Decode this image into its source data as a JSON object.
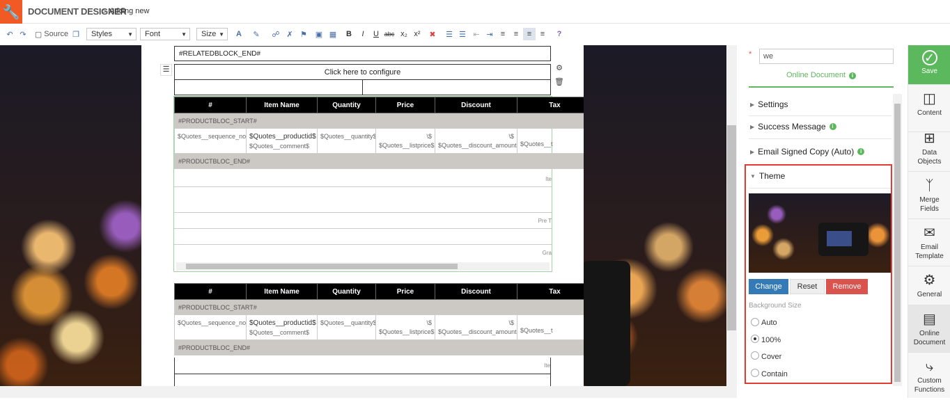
{
  "header": {
    "title": "DOCUMENT DESIGNER",
    "separator": ">",
    "breadcrumb": "Adding new"
  },
  "toolbar": {
    "source_label": "Source",
    "styles_label": "Styles",
    "font_label": "Font",
    "size_label": "Size",
    "help": "?"
  },
  "document": {
    "related_block_end": "#RELATEDBLOCK_END#",
    "configure": "Click here to configure",
    "headers": [
      "#",
      "Item Name",
      "Quantity",
      "Price",
      "Discount",
      "Tax"
    ],
    "block_start": "#PRODUCTBLOC_START#",
    "block_end": "#PRODUCTBLOC_END#",
    "row": {
      "seq": "$Quotes__sequence_no$",
      "product": "$Quotes__productid$",
      "comment": "$Quotes__comment$",
      "quantity": "$Quotes__quantity$",
      "currency": "\\$",
      "listprice": "$Quotes__listprice$",
      "discount": "$Quotes__discount_amount$",
      "tax": "$Quotes__t"
    },
    "summary": {
      "items": "Ite",
      "pretax": "Pre T",
      "grand": "Gra"
    }
  },
  "panel": {
    "required_mark": "*",
    "name_value": "we",
    "online_document_label": "Online Document",
    "sections": {
      "settings": "Settings",
      "success": "Success Message",
      "email_copy": "Email Signed Copy (Auto)",
      "theme": "Theme"
    },
    "buttons": {
      "change": "Change",
      "reset": "Reset",
      "remove": "Remove"
    },
    "bg_size_label": "Background Size",
    "bg_options": [
      "Auto",
      "100%",
      "Cover",
      "Contain"
    ],
    "bg_selected": "100%"
  },
  "rail": {
    "save": "Save",
    "content": "Content",
    "data_objects": "Data Objects",
    "merge_fields": "Merge Fields",
    "email_template": "Email Template",
    "general": "General",
    "online_document": "Online Document",
    "custom_functions": "Custom Functions"
  },
  "colors": {
    "accent": "#f15a24",
    "save": "#5cb85c",
    "change": "#337ab7",
    "remove": "#d9534f",
    "highlight": "#e03c31"
  }
}
